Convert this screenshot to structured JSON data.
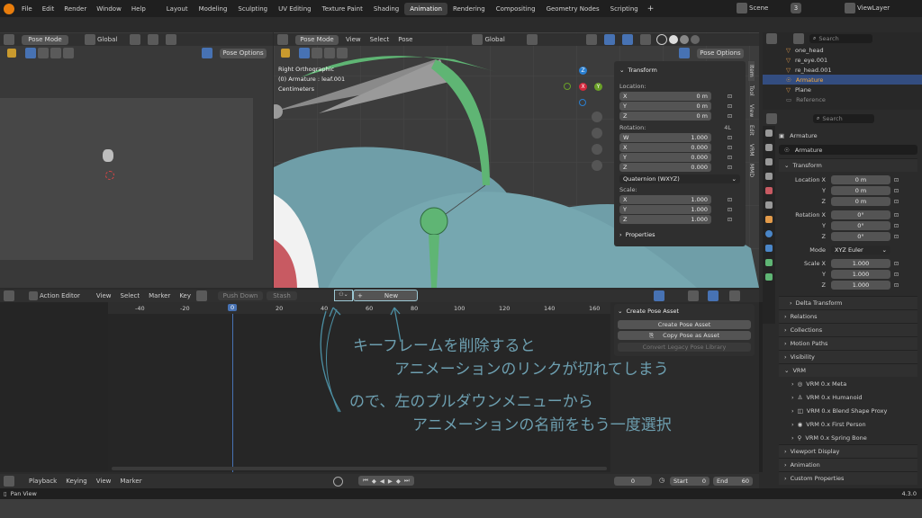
{
  "topbar": {
    "menus": [
      "File",
      "Edit",
      "Render",
      "Window",
      "Help"
    ],
    "workspaces": [
      "Layout",
      "Modeling",
      "Sculpting",
      "UV Editing",
      "Texture Paint",
      "Shading",
      "Animation",
      "Rendering",
      "Compositing",
      "Geometry Nodes",
      "Scripting"
    ],
    "active_workspace": "Animation",
    "scene": "Scene",
    "scene_count": "3",
    "view_layer": "ViewLayer"
  },
  "left_view": {
    "mode": "Pose Mode",
    "transform": "Global",
    "pose_options": "Pose Options"
  },
  "viewport": {
    "mode": "Pose Mode",
    "menus": [
      "View",
      "Select",
      "Pose"
    ],
    "transform": "Global",
    "pose_options": "Pose Options",
    "info_line1": "Right Orthographic",
    "info_line2": "(0) Armature : leaf.001",
    "info_line3": "Centimeters",
    "gizmo": {
      "x": "X",
      "y": "Y",
      "z": "Z"
    },
    "side_tabs": [
      "Item",
      "Tool",
      "View",
      "Edit",
      "VRM",
      "MMD"
    ]
  },
  "npanel": {
    "title": "Transform",
    "location_label": "Location:",
    "location": [
      {
        "axis": "X",
        "value": "0 m"
      },
      {
        "axis": "Y",
        "value": "0 m"
      },
      {
        "axis": "Z",
        "value": "0 m"
      }
    ],
    "rotation_label": "Rotation:",
    "rotation_mode_short": "4L",
    "rotation": [
      {
        "axis": "W",
        "value": "1.000"
      },
      {
        "axis": "X",
        "value": "0.000"
      },
      {
        "axis": "Y",
        "value": "0.000"
      },
      {
        "axis": "Z",
        "value": "0.000"
      }
    ],
    "rotation_mode": "Quaternion (WXYZ)",
    "scale_label": "Scale:",
    "scale": [
      {
        "axis": "X",
        "value": "1.000"
      },
      {
        "axis": "Y",
        "value": "1.000"
      },
      {
        "axis": "Z",
        "value": "1.000"
      }
    ],
    "properties": "Properties"
  },
  "outliner": {
    "search_placeholder": "Search",
    "items": [
      {
        "name": "one_head"
      },
      {
        "name": "re_eye.001"
      },
      {
        "name": "re_head.001"
      },
      {
        "name": "Armature"
      },
      {
        "name": "Plane"
      },
      {
        "name": "Reference"
      }
    ]
  },
  "properties": {
    "search_placeholder": "Search",
    "object_name": "Armature",
    "object_field": "Armature",
    "transform_title": "Transform",
    "location_x_label": "Location X",
    "location": [
      "0 m",
      "0 m",
      "0 m"
    ],
    "rotation_x_label": "Rotation X",
    "rotation": [
      "0°",
      "0°",
      "0°"
    ],
    "axis_y": "Y",
    "axis_z": "Z",
    "mode_label": "Mode",
    "mode_value": "XYZ Euler",
    "scale_x_label": "Scale X",
    "scale": [
      "1.000",
      "1.000",
      "1.000"
    ],
    "sections": [
      "Delta Transform",
      "Relations",
      "Collections",
      "Motion Paths",
      "Visibility"
    ],
    "vrm_title": "VRM",
    "vrm_items": [
      "VRM 0.x Meta",
      "VRM 0.x Humanoid",
      "VRM 0.x Blend Shape Proxy",
      "VRM 0.x First Person",
      "VRM 0.x Spring Bone"
    ],
    "bottom_sections": [
      "Viewport Display",
      "Animation",
      "Custom Properties"
    ]
  },
  "action_editor": {
    "mode": "Action Editor",
    "menus": [
      "View",
      "Select",
      "Marker",
      "Key"
    ],
    "push_down": "Push Down",
    "stash": "Stash",
    "new_label": "New",
    "ruler": [
      "-40",
      "-20",
      "0",
      "20",
      "40",
      "60",
      "80",
      "100",
      "120",
      "140",
      "160"
    ],
    "current_frame_badge": "0"
  },
  "pose_asset": {
    "title": "Create Pose Asset",
    "create": "Create Pose Asset",
    "copy": "Copy Pose as Asset",
    "convert": "Convert Legacy Pose Library"
  },
  "annotation": {
    "line1": "キーフレームを削除すると",
    "line2": "アニメーションのリンクが切れてしまう",
    "line3": "ので、左のプルダウンメニューから",
    "line4": "アニメーションの名前をもう一度選択"
  },
  "timeline": {
    "menus": [
      "Playback",
      "Keying",
      "View",
      "Marker"
    ],
    "current_frame": "0",
    "start_label": "Start",
    "start": "0",
    "end_label": "End",
    "end": "60"
  },
  "status": {
    "left": "Pan View",
    "version": "4.3.0"
  },
  "colors": {
    "accent": "#4772b3",
    "teal": "#6f9ea8",
    "green": "#5fb574",
    "annotation": "#4c8fa3"
  }
}
